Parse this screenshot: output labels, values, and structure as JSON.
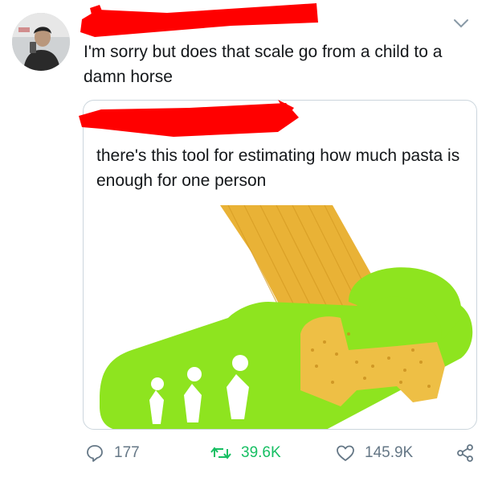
{
  "tweet": {
    "text": "I'm sorry but does that scale go from a child to a damn horse"
  },
  "quoted_tweet": {
    "text": "there's this tool for estimating how much pasta is enough for one person"
  },
  "actions": {
    "replies": "177",
    "retweets": "39.6K",
    "likes": "145.9K"
  },
  "colors": {
    "redaction": "#ff0000",
    "retweet_active": "#17bf63",
    "pasta_tool_green": "#8ee41f",
    "spaghetti": "#e9b236"
  },
  "icons": [
    "chevron-down-icon",
    "reply-icon",
    "retweet-icon",
    "like-icon",
    "share-icon"
  ]
}
